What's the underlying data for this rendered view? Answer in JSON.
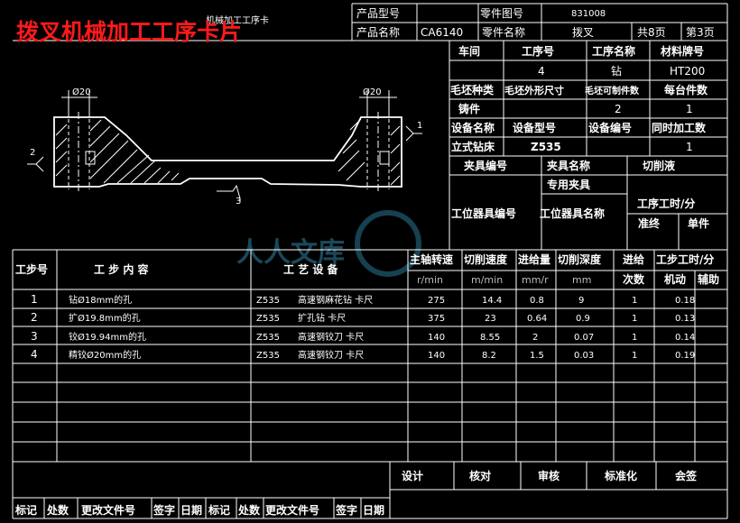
{
  "banner_title": "拨叉机械加工工序卡片",
  "watermark": "人人文库",
  "card_title": "机械加工工序卡",
  "header": {
    "product_model_label": "产品型号",
    "part_drawing_no_label": "零件图号",
    "part_drawing_no_value": "831008",
    "product_name_label": "产品名称",
    "product_name_value": "CA6140",
    "part_name_label": "零件名称",
    "part_name_value": "拨叉",
    "total_pages": "共8页",
    "page_no": "第3页"
  },
  "info": {
    "workshop_label": "车间",
    "op_no_label": "工序号",
    "op_name_label": "工序名称",
    "material_label": "材料牌号",
    "op_no_value": "4",
    "op_name_value": "钻",
    "material_value": "HT200",
    "blank_type_label": "毛坯种类",
    "blank_size_label": "毛坯外形尺寸",
    "per_blank_label": "毛坯可制件数",
    "per_unit_label": "每台件数",
    "blank_type_value": "铸件",
    "per_blank_value": "2",
    "per_unit_value": "1",
    "equip_name_label": "设备名称",
    "equip_model_label": "设备型号",
    "equip_no_label": "设备编号",
    "concurrent_label": "同时加工数",
    "equip_name_value": "立式钻床",
    "equip_model_value": "Z535",
    "concurrent_value": "1",
    "fixture_no_label": "夹具编号",
    "fixture_name_label": "夹具名称",
    "coolant_label": "切削液",
    "fixture_name_value": "专用夹具",
    "station_tool_no_label": "工位器具编号",
    "station_tool_name_label": "工位器具名称",
    "op_time_label": "工序工时/分",
    "prep_label": "准终",
    "unit_label": "单件"
  },
  "drawing": {
    "dim_left": "Ø20",
    "dim_right": "Ø20",
    "datum_2": "2",
    "datum_1": "1",
    "datum_3": "3"
  },
  "steps_header": {
    "step_no": "工步号",
    "content": "工 步 内 容",
    "equipment": "工 艺 设 备",
    "spindle_speed": "主轴转速",
    "cutting_speed": "切削速度",
    "feed": "进给量",
    "depth": "切削深度",
    "passes_1": "进给",
    "passes_2": "次数",
    "step_time": "工步工时/分",
    "machine_time": "机动",
    "aux_time": "辅助",
    "unit_speed": "r/min",
    "unit_cut": "m/min",
    "unit_feed": "mm/r",
    "unit_depth": "mm"
  },
  "steps": [
    {
      "no": "1",
      "content": "钻Ø18mm的孔",
      "machine": "Z535",
      "tool": "高速钢麻花钻 卡尺",
      "speed": "275",
      "vc": "14.4",
      "feed": "0.8",
      "depth": "9",
      "passes": "1",
      "tm": "0.18"
    },
    {
      "no": "2",
      "content": "扩Ø19.8mm的孔",
      "machine": "Z535",
      "tool": "扩孔钻 卡尺",
      "speed": "375",
      "vc": "23",
      "feed": "0.64",
      "depth": "0.9",
      "passes": "1",
      "tm": "0.13"
    },
    {
      "no": "3",
      "content": "铰Ø19.94mm的孔",
      "machine": "Z535",
      "tool": "高速钢铰刀 卡尺",
      "speed": "140",
      "vc": "8.55",
      "feed": "2",
      "depth": "0.07",
      "passes": "1",
      "tm": "0.14"
    },
    {
      "no": "4",
      "content": "精铰Ø20mm的孔",
      "machine": "Z535",
      "tool": "高速钢铰刀 卡尺",
      "speed": "140",
      "vc": "8.2",
      "feed": "1.5",
      "depth": "0.03",
      "passes": "1",
      "tm": "0.19"
    }
  ],
  "sign": {
    "design": "设计",
    "proof": "核对",
    "review": "审核",
    "standard": "标准化",
    "countersign": "会签"
  },
  "revision": {
    "mark": "标记",
    "count": "处数",
    "doc_no": "更改文件号",
    "signature": "签字",
    "date": "日期"
  }
}
